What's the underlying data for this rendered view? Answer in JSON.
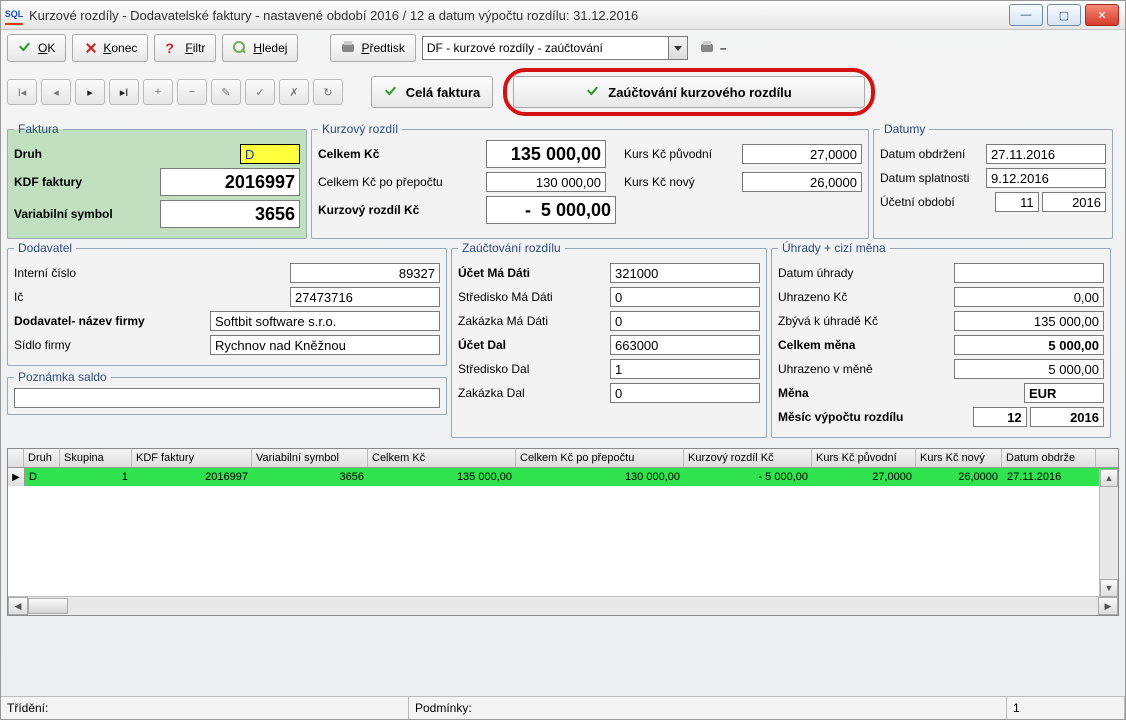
{
  "window": {
    "title": "Kurzové rozdíly - Dodavatelské faktury - nastavené období 2016 / 12 a datum výpočtu rozdílu: 31.12.2016"
  },
  "toolbar": {
    "ok": "OK",
    "konec": "Konec",
    "filtr": "Filtr",
    "hledej": "Hledej",
    "predtisk": "Předtisk",
    "combo": "DF - kurzové rozdíly - zaúčtování"
  },
  "actions": {
    "cela_faktura": "Celá faktura",
    "zauctovani": "Zaúčtování kurzového rozdílu"
  },
  "faktura": {
    "legend": "Faktura",
    "druh_label": "Druh",
    "druh": "D",
    "kdf_label": "KDF faktury",
    "kdf": "2016997",
    "vs_label": "Variabilní symbol",
    "vs": "3656"
  },
  "kurz": {
    "legend": "Kurzový rozdíl",
    "celkem_label": "Celkem Kč",
    "celkem": "135 000,00",
    "celkem_prepocet_label": "Celkem Kč po přepočtu",
    "celkem_prepocet": "130 000,00",
    "rozdil_label": "Kurzový rozdíl Kč",
    "rozdil": "-  5 000,00",
    "kurs_puv_label": "Kurs Kč původní",
    "kurs_puv": "27,0000",
    "kurs_novy_label": "Kurs Kč nový",
    "kurs_novy": "26,0000"
  },
  "datumy": {
    "legend": "Datumy",
    "obdrzeni_label": "Datum obdržení",
    "obdrzeni": "27.11.2016",
    "splatnost_label": "Datum splatnosti",
    "splatnost": "9.12.2016",
    "ucetni_obd_label": "Účetní období",
    "ucetni_mes": "11",
    "ucetni_rok": "2016"
  },
  "dodavatel": {
    "legend": "Dodavatel",
    "interni_label": "Interní číslo",
    "interni": "89327",
    "ic_label": "Ič",
    "ic": "27473716",
    "nazev_label": "Dodavatel- název firmy",
    "nazev": "Softbit software s.r.o.",
    "sidlo_label": "Sídlo firmy",
    "sidlo": "Rychnov nad Kněžnou"
  },
  "zauctovani": {
    "legend": "Zaúčtování rozdílu",
    "ucet_md_label": "Účet Má Dáti",
    "ucet_md": "321000",
    "str_md_label": "Středisko Má Dáti",
    "str_md": "0",
    "zak_md_label": "Zakázka  Má Dáti",
    "zak_md": "0",
    "ucet_dal_label": "Účet Dal",
    "ucet_dal": "663000",
    "str_dal_label": "Středisko Dal",
    "str_dal": "1",
    "zak_dal_label": "Zakázka Dal",
    "zak_dal": "0"
  },
  "uhrady": {
    "legend": "Úhrady + cizí měna",
    "datum_label": "Datum úhrady",
    "datum": "",
    "uhrazeno_label": "Uhrazeno Kč",
    "uhrazeno": "0,00",
    "zbyva_label": "Zbývá k úhradě Kč",
    "zbyva": "135 000,00",
    "celkem_mena_label": "Celkem měna",
    "celkem_mena": "5 000,00",
    "uhrazeno_mena_label": "Uhrazeno v měně",
    "uhrazeno_mena": "5 000,00",
    "mena_label": "Měna",
    "mena": "EUR",
    "mesic_label": "Měsíc výpočtu rozdílu",
    "mesic": "12",
    "rok": "2016"
  },
  "poznamka": {
    "legend": "Poznámka saldo",
    "value": ""
  },
  "grid": {
    "headers": [
      "Druh",
      "Skupina",
      "KDF faktury",
      "Variabilní symbol",
      "Celkem Kč",
      "Celkem Kč po přepočtu",
      "Kurzový rozdíl Kč",
      "Kurs Kč původní",
      "Kurs Kč nový",
      "Datum obdrže"
    ],
    "row": {
      "druh": "D",
      "skupina": "1",
      "kdf": "2016997",
      "vs": "3656",
      "celkem": "135 000,00",
      "celkem_prepocet": "130 000,00",
      "rozdil": "- 5 000,00",
      "kurs_puv": "27,0000",
      "kurs_novy": "26,0000",
      "datum_obdr": "27.11.2016"
    }
  },
  "status": {
    "trideni": "Třídění:",
    "podminky": "Podmínky:",
    "count": "1"
  }
}
